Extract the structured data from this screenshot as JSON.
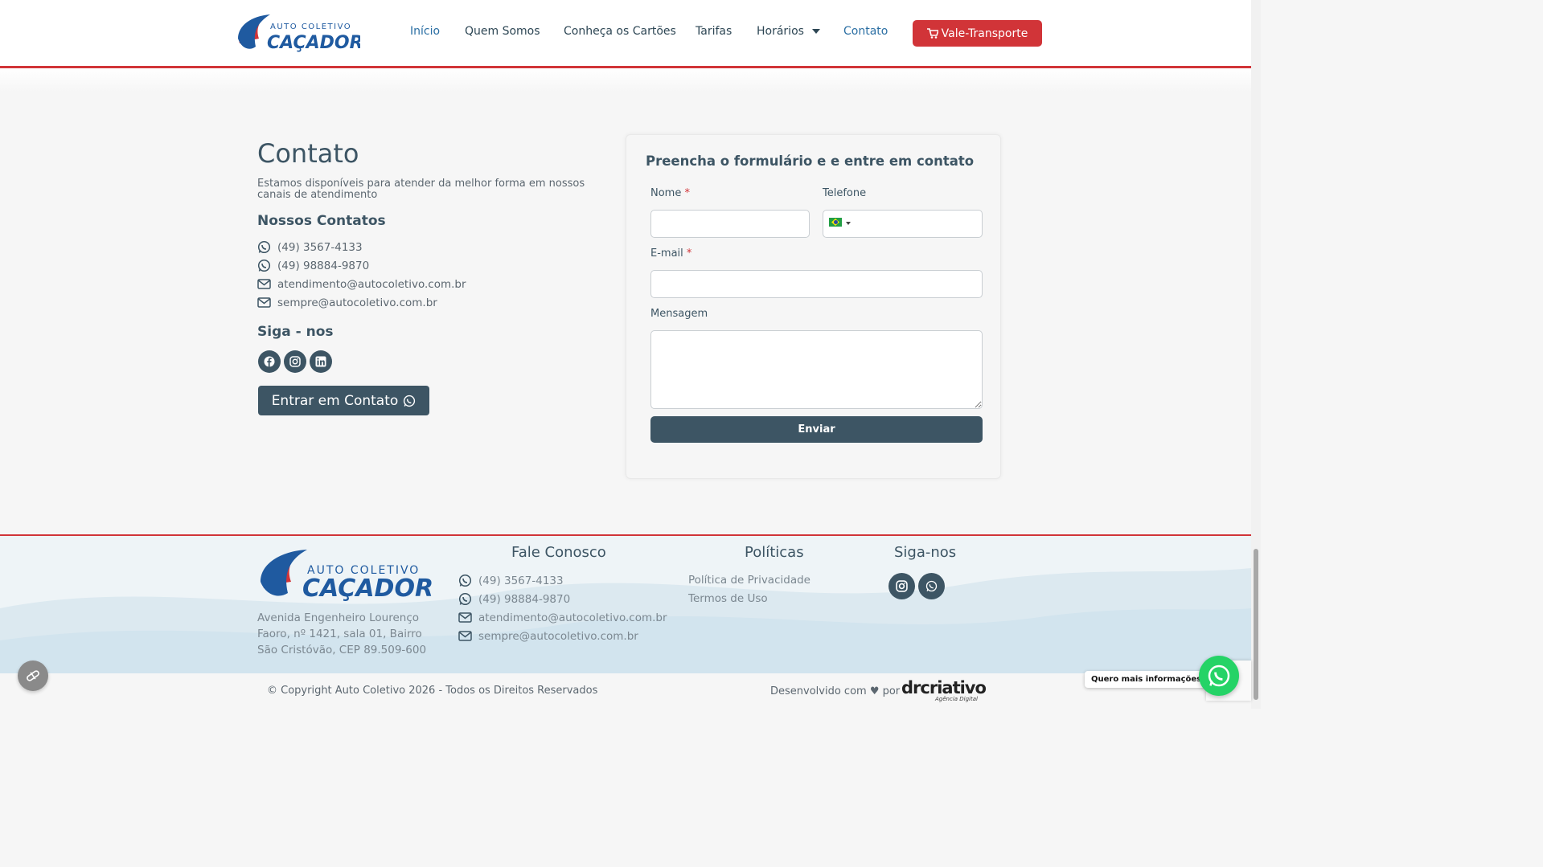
{
  "brand": {
    "logo_line1": "AUTO COLETIVO",
    "logo_line2": "CAÇADOR",
    "red": "#d13438",
    "blue": "#1f5aa0",
    "slate": "#3d5564"
  },
  "nav": {
    "items": [
      {
        "label": "Início",
        "active": true
      },
      {
        "label": "Quem Somos"
      },
      {
        "label": "Conheça os Cartões"
      },
      {
        "label": "Tarifas"
      },
      {
        "label": "Horários",
        "has_dropdown": true
      },
      {
        "label": "Contato",
        "active": true
      }
    ],
    "cta_label": "Vale-Transporte",
    "cta_icon": "cart-icon"
  },
  "contact": {
    "title": "Contato",
    "subtitle": "Estamos disponíveis para atender da melhor forma em nossos canais de atendimento",
    "contacts_heading": "Nossos Contatos",
    "items": [
      {
        "icon": "whatsapp-icon",
        "text": "(49) 3567-4133"
      },
      {
        "icon": "whatsapp-icon",
        "text": "(49) 98884-9870"
      },
      {
        "icon": "mail-icon",
        "text": "atendimento@autocoletivo.com.br"
      },
      {
        "icon": "mail-icon",
        "text": "sempre@autocoletivo.com.br"
      }
    ],
    "follow_heading": "Siga - nos",
    "socials": [
      "facebook-icon",
      "instagram-icon",
      "linkedin-icon"
    ],
    "button_label": "Entrar em Contato"
  },
  "form": {
    "title": "Preencha o formulário e e entre em contato",
    "name_label": "Nome",
    "phone_label": "Telefone",
    "email_label": "E-mail",
    "message_label": "Mensagem",
    "required_mark": "*",
    "name_value": "",
    "phone_value": "",
    "email_value": "",
    "message_value": "",
    "submit_label": "Enviar"
  },
  "footer": {
    "logo_line1": "AUTO COLETIVO",
    "logo_line2": "CAÇADOR",
    "address": "Avenida Engenheiro Lourenço Faoro, nº 1421, sala 01, Bairro São Cristóvão, CEP 89.509-600",
    "talk_heading": "Fale Conosco",
    "talk_items": [
      {
        "icon": "whatsapp-icon",
        "text": "(49) 3567-4133"
      },
      {
        "icon": "whatsapp-icon",
        "text": "(49) 98884-9870"
      },
      {
        "icon": "mail-icon",
        "text": "atendimento@autocoletivo.com.br"
      },
      {
        "icon": "mail-icon",
        "text": "sempre@autocoletivo.com.br"
      }
    ],
    "policies_heading": "Políticas",
    "policies": [
      "Política de Privacidade",
      "Termos de Uso"
    ],
    "follow_heading": "Siga-nos",
    "socials": [
      "instagram-icon",
      "whatsapp-icon"
    ],
    "copyright": "© Copyright Auto Coletivo 2026 - Todos os Direitos Reservados",
    "developed_by": "Desenvolvido com ♥ por",
    "agency_name": "drcriativo",
    "agency_tagline": "Agência Digital"
  },
  "widgets": {
    "whatsapp_bubble": "Quero mais informações!"
  }
}
